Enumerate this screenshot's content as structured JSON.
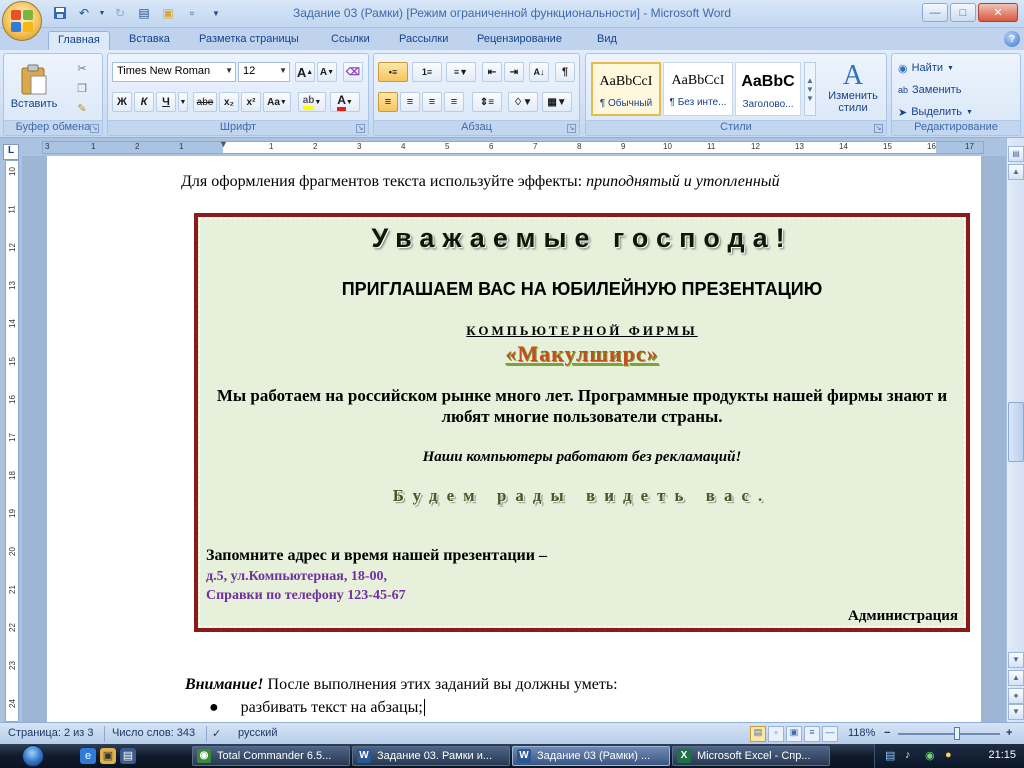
{
  "window": {
    "title": "Задание 03 (Рамки) [Режим ограниченной функциональности] - Microsoft Word"
  },
  "tabs": [
    {
      "label": "Главная",
      "active": true
    },
    {
      "label": "Вставка"
    },
    {
      "label": "Разметка страницы"
    },
    {
      "label": "Ссылки"
    },
    {
      "label": "Рассылки"
    },
    {
      "label": "Рецензирование"
    },
    {
      "label": "Вид"
    }
  ],
  "ribbon": {
    "clipboard": {
      "paste_label": "Вставить",
      "group_label": "Буфер обмена"
    },
    "font": {
      "family": "Times New Roman",
      "size": "12",
      "group_label": "Шрифт",
      "bold": "Ж",
      "italic": "К",
      "underline": "Ч",
      "strike": "abe",
      "subscript": "x₂",
      "superscript": "x²",
      "case": "Aa",
      "grow": "A",
      "shrink": "A"
    },
    "paragraph": {
      "group_label": "Абзац"
    },
    "styles": {
      "group_label": "Стили",
      "items": [
        {
          "sample": "AaBbCcI",
          "name": "¶ Обычный"
        },
        {
          "sample": "AaBbCcI",
          "name": "¶ Без инте..."
        },
        {
          "sample": "AaBbC",
          "name": "Заголово..."
        }
      ],
      "change_styles": "Изменить стили"
    },
    "editing": {
      "group_label": "Редактирование",
      "find": "Найти",
      "replace": "Заменить",
      "select": "Выделить"
    }
  },
  "ruler": {
    "h_numbers": [
      "3",
      "1",
      "2",
      "1",
      "1",
      "2",
      "3",
      "4",
      "5",
      "6",
      "7",
      "8",
      "9",
      "10",
      "11",
      "12",
      "13",
      "14",
      "15",
      "16",
      "17"
    ],
    "v_numbers": [
      "10",
      "11",
      "12",
      "13",
      "14",
      "15",
      "16",
      "17",
      "18",
      "19",
      "20",
      "21",
      "22",
      "23",
      "24"
    ]
  },
  "document": {
    "line_top": "Для оформления фрагментов текста используйте эффекты: ",
    "line_top_italic": "приподнятый и утопленный",
    "frame": {
      "heading": "Уважаемые господа!",
      "invite": "ПРИГЛАШАЕМ ВАС НА ЮБИЛЕЙНУЮ ПРЕЗЕНТАЦИЮ",
      "company_caption": "КОМПЬЮТЕРНОЙ ФИРМЫ",
      "company_name": "«Макулширс»",
      "about": "Мы работаем на российском рынке много лет. Программные продукты нашей фирмы знают и любят многие пользователи страны.",
      "slogan": "Наши компьютеры работают без рекламаций!",
      "welcome": "Будем рады видеть вас.",
      "remember": "Запомните адрес и время нашей презентации –",
      "address": "д.5, ул.Компьютерная, 18-00,",
      "phone": "Справки по телефону 123-45-67",
      "signature": "Администрация"
    },
    "attention_label": "Внимание!",
    "attention_text": " После выполнения этих заданий вы должны уметь:",
    "bullet_1": "разбивать текст на абзацы;"
  },
  "status": {
    "page": "Страница: 2 из 3",
    "words": "Число слов: 343",
    "language": "русский",
    "zoom": "118%"
  },
  "taskbar": {
    "items": [
      {
        "label": "Total Commander 6.5...",
        "icon": "total-commander-icon"
      },
      {
        "label": "Задание 03. Рамки и...",
        "icon": "word-icon"
      },
      {
        "label": "Задание 03 (Рамки) ...",
        "icon": "word-icon",
        "active": true
      },
      {
        "label": "Microsoft Excel - Спр...",
        "icon": "excel-icon"
      }
    ],
    "clock": "21:15"
  }
}
